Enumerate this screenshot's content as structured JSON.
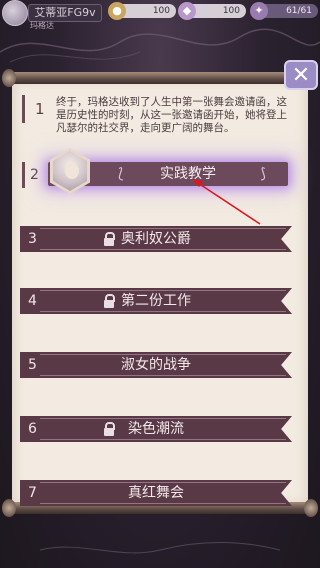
{
  "status_bar": {
    "player_name": "艾蒂亚FG9v",
    "sub_tag": "玛格达",
    "coins": "100",
    "gems": "100",
    "energy": "61/61"
  },
  "close_label": "✕",
  "chapters": [
    {
      "number": "1",
      "description": "终于，玛格达收到了人生中第一张舞会邀请函，这是历史性的时刻，从这一张邀请函开始，她将登上凡瑟尔的社交界，走向更广阔的舞台。"
    },
    {
      "number": "2",
      "title": "实践教学",
      "locked": false,
      "active": true,
      "ornament_left": "⟅",
      "ornament_right": "⟆"
    },
    {
      "number": "3",
      "title": "奥利奴公爵",
      "locked": true
    },
    {
      "number": "4",
      "title": "第二份工作",
      "locked": true
    },
    {
      "number": "5",
      "title": "淑女的战争",
      "locked": false
    },
    {
      "number": "6",
      "title": "染色潮流",
      "locked": true
    },
    {
      "number": "7",
      "title": "真红舞会",
      "locked": false
    }
  ],
  "colors": {
    "ribbon": "#5a3946",
    "active_glow": "#b48ce6",
    "paper": "#f3ebe1",
    "guide_arrow": "#e0141e"
  },
  "icons": {
    "lock": "lock-icon",
    "close": "close-icon",
    "coin": "coin-icon",
    "gem": "gem-icon",
    "energy": "energy-icon"
  }
}
